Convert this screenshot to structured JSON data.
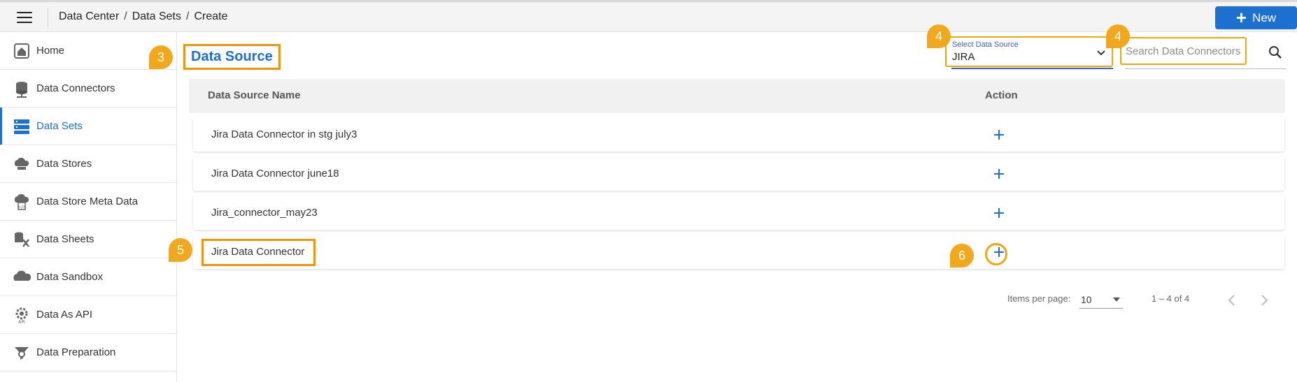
{
  "header": {
    "breadcrumb": [
      "Data Center",
      "Data Sets",
      "Create"
    ],
    "new_label": "New"
  },
  "sidebar": {
    "items": [
      {
        "label": "Home",
        "icon": "home-icon",
        "active": false
      },
      {
        "label": "Data Connectors",
        "icon": "data-connectors-icon",
        "active": false
      },
      {
        "label": "Data Sets",
        "icon": "data-sets-icon",
        "active": true
      },
      {
        "label": "Data Stores",
        "icon": "data-stores-icon",
        "active": false
      },
      {
        "label": "Data Store Meta Data",
        "icon": "data-store-meta-icon",
        "active": false
      },
      {
        "label": "Data Sheets",
        "icon": "data-sheets-icon",
        "active": false
      },
      {
        "label": "Data Sandbox",
        "icon": "data-sandbox-icon",
        "active": false
      },
      {
        "label": "Data As API",
        "icon": "data-api-icon",
        "active": false
      },
      {
        "label": "Data Preparation",
        "icon": "data-preparation-icon",
        "active": false
      }
    ]
  },
  "main": {
    "title": "Data Source",
    "select": {
      "label": "Select Data Source",
      "value": "JIRA"
    },
    "search": {
      "placeholder": "Search Data Connectors"
    },
    "table": {
      "columns": [
        "Data Source Name",
        "Action"
      ],
      "rows": [
        "Jira Data Connector in stg july3",
        "Jira Data Connector june18",
        "Jira_connector_may23",
        "Jira Data Connector"
      ]
    },
    "pagination": {
      "items_per_page_label": "Items per page:",
      "items_per_page": "10",
      "range": "1 – 4 of 4"
    }
  },
  "annotations": [
    "3",
    "4",
    "4",
    "5",
    "6"
  ],
  "colors": {
    "accent": "#1d6fd0",
    "highlight": "#f0930e",
    "badge": "#f2a81d"
  }
}
